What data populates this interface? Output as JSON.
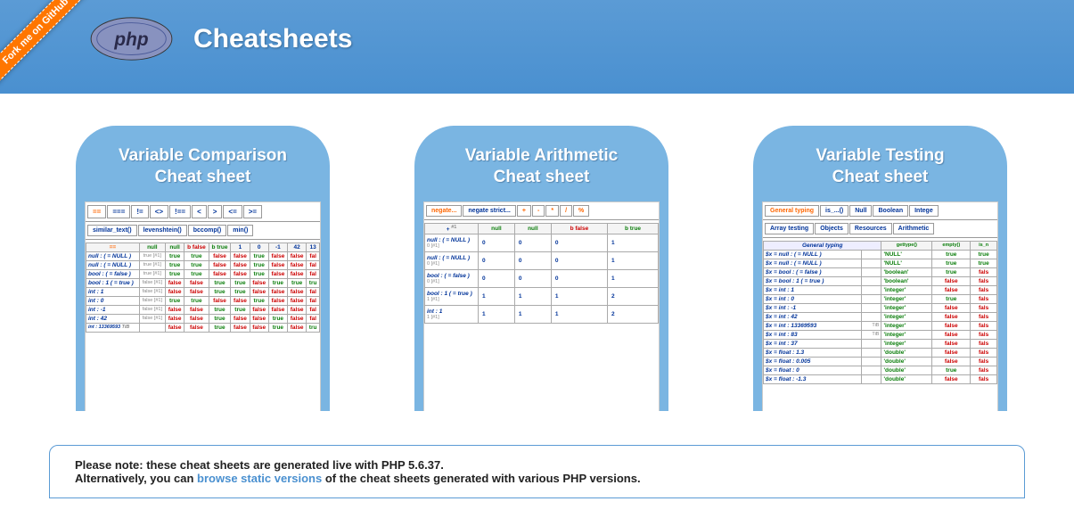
{
  "fork_label": "Fork me on GitHub",
  "header": {
    "logo_text": "php",
    "title": "Cheatsheets"
  },
  "cards": [
    {
      "title_l1": "Variable Comparison",
      "title_l2": "Cheat sheet"
    },
    {
      "title_l1": "Variable Arithmetic",
      "title_l2": "Cheat sheet"
    },
    {
      "title_l1": "Variable Testing",
      "title_l2": "Cheat sheet"
    }
  ],
  "comparison": {
    "tabs_row1": [
      "==",
      "===",
      "!=",
      "<>",
      "!==",
      "<",
      ">",
      "<=",
      ">="
    ],
    "tabs_row2": [
      "similar_text()",
      "levenshtein()",
      "bccomp()",
      "min()"
    ],
    "cols": [
      "null",
      "null",
      "b false",
      "b true",
      "1",
      "0",
      "-1",
      "42",
      "13"
    ],
    "rows": [
      {
        "l": "null : ( = NULL )",
        "sub": "true [#1]",
        "v": [
          "true",
          "true",
          "false",
          "false",
          "true",
          "false",
          "false",
          "fal"
        ]
      },
      {
        "l": "null : ( = NULL )",
        "sub": "true [#1]",
        "v": [
          "true",
          "true",
          "false",
          "false",
          "true",
          "false",
          "false",
          "fal"
        ]
      },
      {
        "l": "bool : ( = false )",
        "sub": "true [#1]",
        "v": [
          "true",
          "true",
          "false",
          "false",
          "true",
          "false",
          "false",
          "fal"
        ]
      },
      {
        "l": "bool : 1 ( = true )",
        "sub": "false [#1]",
        "v": [
          "false",
          "false",
          "true",
          "true",
          "false",
          "true",
          "true",
          "tru"
        ]
      },
      {
        "l": "int : 1",
        "sub": "false [#1]",
        "v": [
          "false",
          "false",
          "true",
          "true",
          "false",
          "false",
          "false",
          "fal"
        ]
      },
      {
        "l": "int : 0",
        "sub": "false [#1]",
        "v": [
          "true",
          "true",
          "false",
          "false",
          "true",
          "false",
          "false",
          "fal"
        ]
      },
      {
        "l": "int : -1",
        "sub": "false [#1]",
        "v": [
          "false",
          "false",
          "true",
          "true",
          "false",
          "false",
          "false",
          "fal"
        ]
      },
      {
        "l": "int : 42",
        "sub": "false [#1]",
        "v": [
          "false",
          "false",
          "true",
          "false",
          "false",
          "true",
          "false",
          "fal"
        ]
      },
      {
        "l": "int : 13369593",
        "sub": "",
        "v": [
          "false",
          "false",
          "true",
          "false",
          "false",
          "true",
          "false",
          "tru"
        ]
      }
    ]
  },
  "arithmetic": {
    "tabs": [
      "negate...",
      "negate strict...",
      "+",
      "-",
      "*",
      "/",
      "%"
    ],
    "cols": [
      "null",
      "null",
      "b false",
      "b true"
    ],
    "rows": [
      {
        "l": "null : ( = NULL )",
        "sub": "0 [#1]",
        "v": [
          "0",
          "0",
          "0",
          "1"
        ]
      },
      {
        "l": "null : ( = NULL )",
        "sub": "0 [#1]",
        "v": [
          "0",
          "0",
          "0",
          "1"
        ]
      },
      {
        "l": "bool : ( = false )",
        "sub": "0 [#1]",
        "v": [
          "0",
          "0",
          "0",
          "1"
        ]
      },
      {
        "l": "bool : 1 ( = true )",
        "sub": "1 [#1]",
        "v": [
          "1",
          "1",
          "1",
          "2"
        ]
      },
      {
        "l": "int : 1",
        "sub": "1 [#1]",
        "v": [
          "1",
          "1",
          "1",
          "2"
        ]
      }
    ]
  },
  "testing": {
    "tabs_row1": [
      "General typing",
      "is_...()",
      "Null",
      "Boolean",
      "Intege"
    ],
    "tabs_row2": [
      "Array testing",
      "Objects",
      "Resources",
      "Arithmetic"
    ],
    "cat_label": "General typing",
    "cols": [
      "gettype()",
      "empty()",
      "is_n"
    ],
    "rows": [
      {
        "l": "$x = null : ( = NULL )",
        "t": "'NULL'",
        "v": [
          "true",
          "true"
        ]
      },
      {
        "l": "$x = null : ( = NULL )",
        "t": "'NULL'",
        "v": [
          "true",
          "true"
        ]
      },
      {
        "l": "$x = bool : ( = false )",
        "t": "'boolean'",
        "v": [
          "true",
          "fals"
        ]
      },
      {
        "l": "$x = bool : 1 ( = true )",
        "t": "'boolean'",
        "v": [
          "false",
          "fals"
        ]
      },
      {
        "l": "$x = int : 1",
        "t": "'integer'",
        "v": [
          "false",
          "fals"
        ]
      },
      {
        "l": "$x = int : 0",
        "t": "'integer'",
        "v": [
          "true",
          "fals"
        ]
      },
      {
        "l": "$x = int : -1",
        "t": "'integer'",
        "v": [
          "false",
          "fals"
        ]
      },
      {
        "l": "$x = int : 42",
        "t": "'integer'",
        "v": [
          "false",
          "fals"
        ]
      },
      {
        "l": "$x = int : 13369593",
        "t": "'integer'",
        "v": [
          "false",
          "fals"
        ],
        "hint": "TiB"
      },
      {
        "l": "$x = int : 83",
        "t": "'integer'",
        "v": [
          "false",
          "fals"
        ],
        "hint": "TiB"
      },
      {
        "l": "$x = int : 37",
        "t": "'integer'",
        "v": [
          "false",
          "fals"
        ]
      },
      {
        "l": "$x = float : 1.3",
        "t": "'double'",
        "v": [
          "false",
          "fals"
        ]
      },
      {
        "l": "$x = float : 0.005",
        "t": "'double'",
        "v": [
          "false",
          "fals"
        ]
      },
      {
        "l": "$x = float : 0",
        "t": "'double'",
        "v": [
          "true",
          "fals"
        ]
      },
      {
        "l": "$x = float : -1.3",
        "t": "'double'",
        "v": [
          "false",
          "fals"
        ]
      }
    ]
  },
  "note": {
    "line1_pre": "Please note: these cheat sheets are generated live with ",
    "php_ver": "PHP 5.6.37",
    "line1_post": ".",
    "line2_pre": "Alternatively, you can ",
    "link": "browse static versions",
    "line2_post": " of the cheat sheets generated with various PHP versions."
  }
}
